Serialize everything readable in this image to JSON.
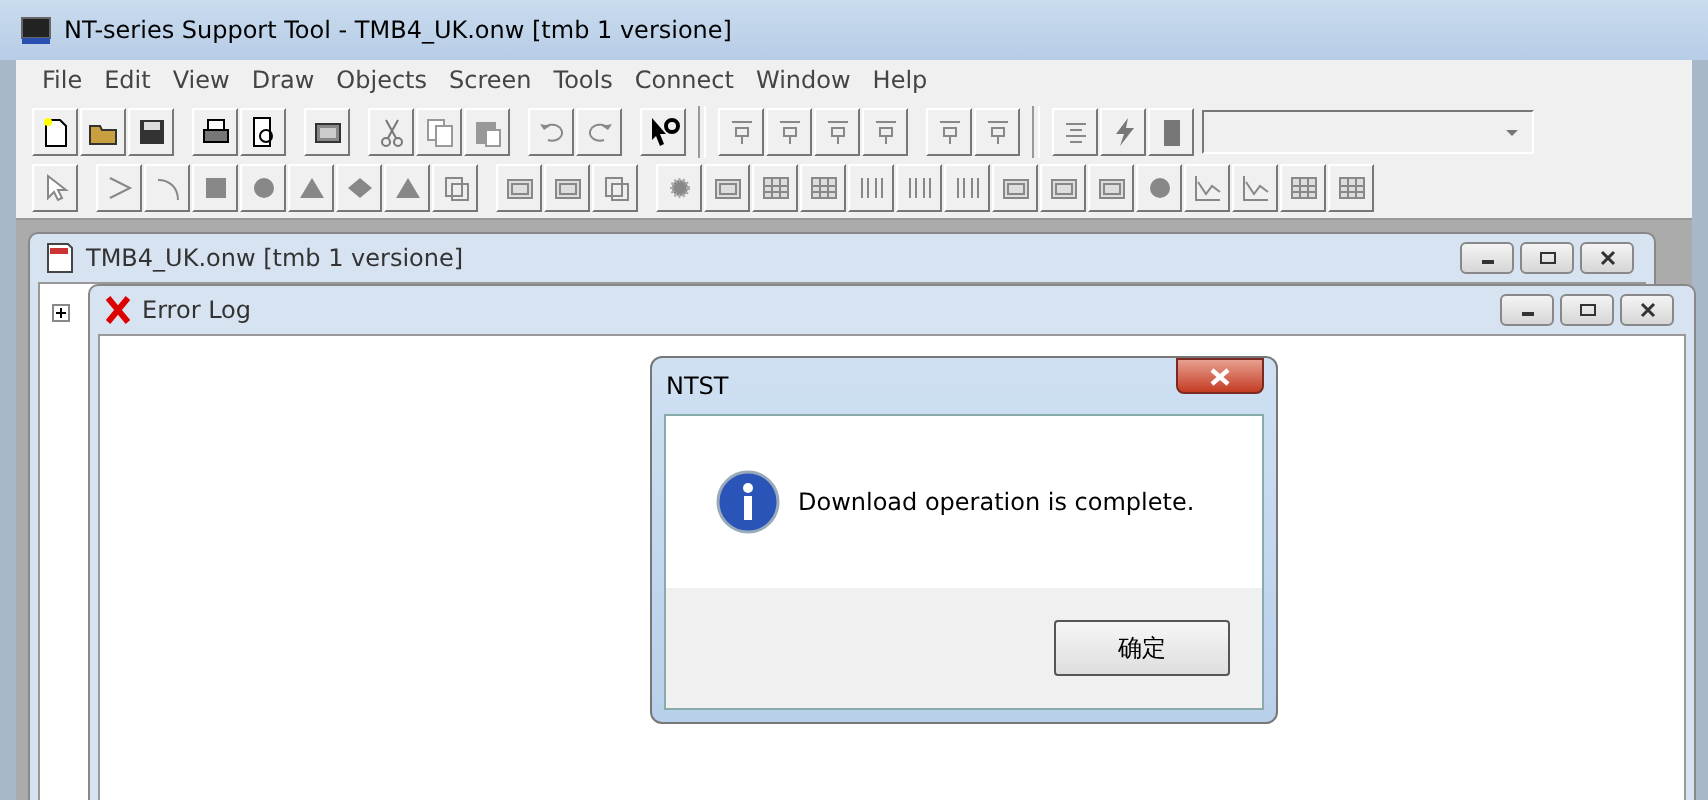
{
  "window": {
    "title": "NT-series Support Tool - TMB4_UK.onw [tmb 1 versione]"
  },
  "menu": [
    "File",
    "Edit",
    "View",
    "Draw",
    "Objects",
    "Screen",
    "Tools",
    "Connect",
    "Window",
    "Help"
  ],
  "child_window": {
    "title": "TMB4_UK.onw [tmb 1 versione]"
  },
  "error_log": {
    "title": "Error Log"
  },
  "dialog": {
    "title": "NTST",
    "message": "Download operation is complete.",
    "button": "确定"
  }
}
